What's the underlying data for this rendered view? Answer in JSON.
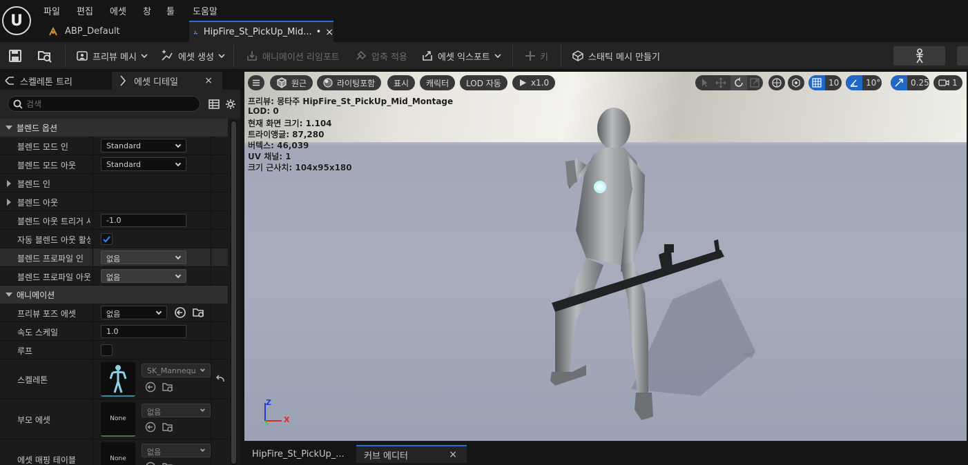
{
  "menu": {
    "logo": "U",
    "items": [
      "파일",
      "편집",
      "에셋",
      "창",
      "툴",
      "도움말"
    ]
  },
  "doc_tabs": [
    {
      "label": "ABP_Default"
    },
    {
      "label": "HipFire_St_PickUp_Mid...",
      "modified": "•",
      "close": "×"
    }
  ],
  "toolbar": {
    "preview_mesh": "프리뷰 메시",
    "asset_create": "에셋 생성",
    "anim_reimport": "애니메이션 리임포트",
    "apply_compression": "압축 적용",
    "export_asset": "에셋 익스포트",
    "key": "키",
    "make_static_mesh": "스태틱 메시 만들기"
  },
  "left_tabs": {
    "skeleton_tree": "스켈레톤 트리",
    "asset_details": "에셋 디테일",
    "close": "×"
  },
  "search": {
    "placeholder": "검색"
  },
  "blend_options": {
    "title": "블렌드 옵션",
    "blend_mode_in": {
      "label": "블렌드 모드 인",
      "value": "Standard"
    },
    "blend_mode_out": {
      "label": "블렌드 모드 아웃",
      "value": "Standard"
    },
    "blend_in": {
      "label": "블렌드 인"
    },
    "blend_out": {
      "label": "블렌드 아웃"
    },
    "blend_out_trigger": {
      "label": "블렌드 아웃 트리거 시...",
      "value": "-1.0"
    },
    "auto_blend_out": {
      "label": "자동 블렌드 아웃 활성...",
      "checked": true
    },
    "blend_profile_in": {
      "label": "블렌드 프로파일 인",
      "value": "없음"
    },
    "blend_profile_out": {
      "label": "블렌드 프로파일 아웃",
      "value": "없음"
    }
  },
  "animation": {
    "title": "애니메이션",
    "preview_pose_asset": {
      "label": "프리뷰 포즈 에셋",
      "value": "없음"
    },
    "rate_scale": {
      "label": "속도 스케일",
      "value": "1.0"
    },
    "loop": {
      "label": "루프",
      "checked": false
    },
    "skeleton": {
      "label": "스켈레톤",
      "value": "SK_Mannequ"
    },
    "parent_asset": {
      "label": "부모 에셋",
      "value": "없음",
      "thumb": "None"
    },
    "asset_mapping_table": {
      "label": "에셋 매핑 테이블",
      "value": "없음",
      "thumb": "None"
    }
  },
  "viewport": {
    "toolbar": {
      "perspective": "원근",
      "lit": "라이팅포함",
      "show": "표시",
      "character": "캐릭터",
      "lod": "LOD 자동",
      "play_rate": "x1.0",
      "grid_snap": "10",
      "rotation_snap": "10°",
      "scale_snap": "0.25",
      "camera_speed": "1"
    },
    "stats": [
      "프리뷰: 몽타주 HipFire_St_PickUp_Mid_Montage",
      "LOD: 0",
      "현재 화면 크기: 1.104",
      "트라이앵글: 87,280",
      "버텍스: 46,039",
      "UV 채널: 1",
      "크기 근사치: 104x95x180"
    ],
    "axis": {
      "x": "X",
      "z": "Z"
    }
  },
  "bottom_tabs": [
    {
      "label": "HipFire_St_PickUp_..."
    },
    {
      "label": "커브 에디터",
      "close": "×"
    }
  ],
  "colors": {
    "accent": "#2a6fd6",
    "check": "#1f6fd6"
  }
}
